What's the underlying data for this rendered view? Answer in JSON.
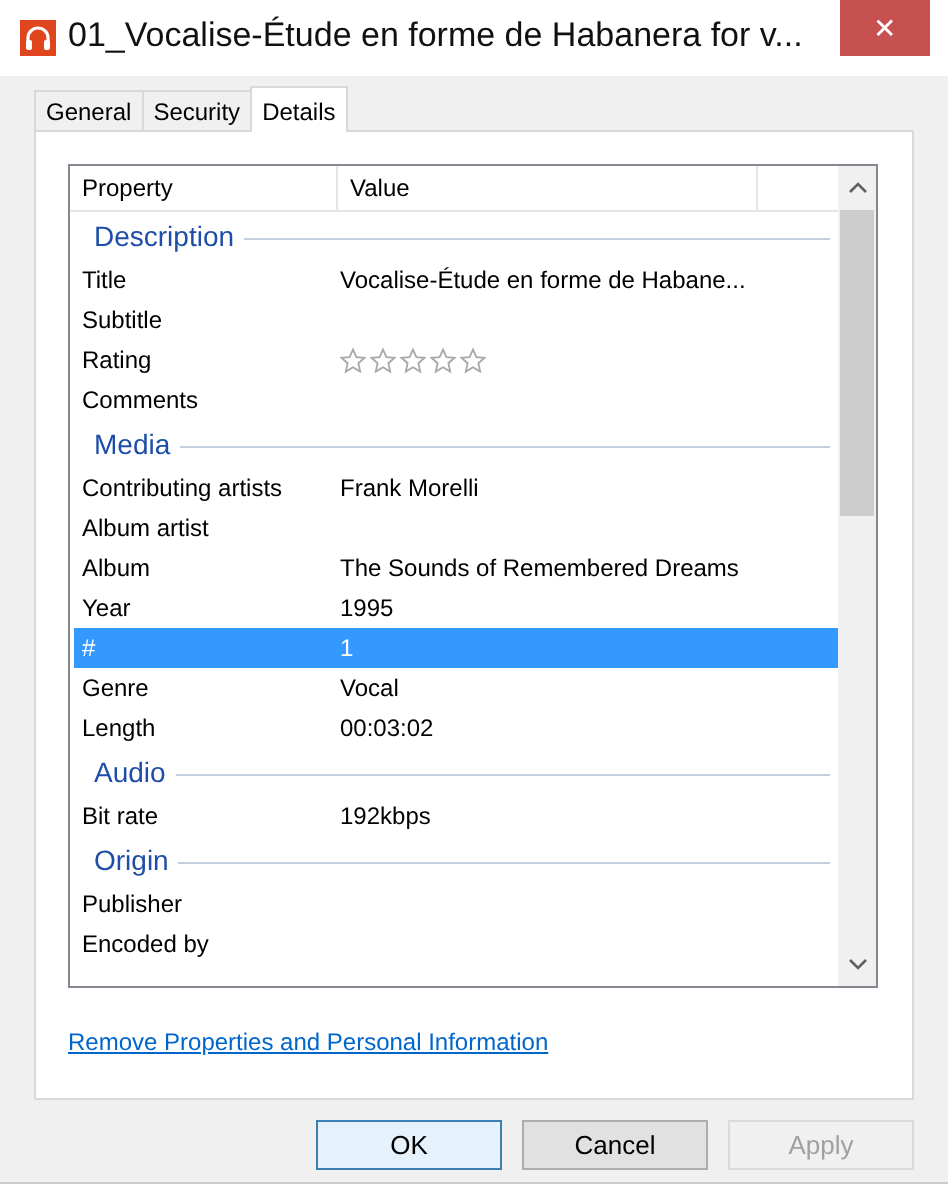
{
  "window": {
    "title": "01_Vocalise-Étude en forme de Habanera for v...",
    "close": "✕"
  },
  "tabs": [
    {
      "label": "General",
      "selected": false
    },
    {
      "label": "Security",
      "selected": false
    },
    {
      "label": "Details",
      "selected": true
    }
  ],
  "table": {
    "columns": [
      "Property",
      "Value"
    ],
    "rows": [
      {
        "kind": "section",
        "label": "Description"
      },
      {
        "kind": "property",
        "name": "Title",
        "value": "Vocalise-Étude en forme de Habane...",
        "selected": false
      },
      {
        "kind": "property",
        "name": "Subtitle",
        "selected": false
      },
      {
        "kind": "rating",
        "name": "Rating",
        "stars": 0,
        "selected": false
      },
      {
        "kind": "property",
        "name": "Comments",
        "selected": false
      },
      {
        "kind": "section",
        "label": "Media"
      },
      {
        "kind": "property",
        "name": "Contributing artists",
        "value": "Frank Morelli",
        "selected": false
      },
      {
        "kind": "property",
        "name": "Album artist",
        "selected": false
      },
      {
        "kind": "property",
        "name": "Album",
        "value": "The Sounds of Remembered Dreams",
        "selected": false
      },
      {
        "kind": "property",
        "name": "Year",
        "value": "1995",
        "selected": false
      },
      {
        "kind": "property",
        "name": "#",
        "value": "1",
        "selected": true
      },
      {
        "kind": "property",
        "name": "Genre",
        "value": "Vocal",
        "selected": false
      },
      {
        "kind": "property",
        "name": "Length",
        "value": "00:03:02",
        "selected": false
      },
      {
        "kind": "section",
        "label": "Audio"
      },
      {
        "kind": "property",
        "name": "Bit rate",
        "value": "192kbps",
        "selected": false
      },
      {
        "kind": "section",
        "label": "Origin"
      },
      {
        "kind": "property",
        "name": "Publisher",
        "selected": false
      },
      {
        "kind": "property",
        "name": "Encoded by",
        "selected": false
      }
    ]
  },
  "link": "Remove Properties and Personal Information",
  "buttons": [
    {
      "label": "OK",
      "disabled": false,
      "default": true
    },
    {
      "label": "Cancel",
      "disabled": false,
      "default": false
    },
    {
      "label": "Apply",
      "disabled": true,
      "default": false
    }
  ]
}
